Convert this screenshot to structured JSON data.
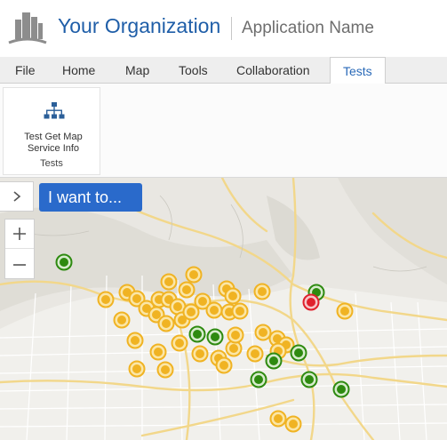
{
  "header": {
    "org_name": "Your Organization",
    "app_name": "Application Name",
    "logo_icon": "city-buildings-logo"
  },
  "ribbon": {
    "tabs": [
      {
        "label": "File",
        "active": false
      },
      {
        "label": "Home",
        "active": false
      },
      {
        "label": "Map",
        "active": false
      },
      {
        "label": "Tools",
        "active": false
      },
      {
        "label": "Collaboration",
        "active": false
      },
      {
        "label": "Tests",
        "active": true
      }
    ],
    "groups": [
      {
        "label": "Tests",
        "tools": [
          {
            "label": "Test Get Map Service Info",
            "icon": "hierarchy-icon"
          }
        ]
      }
    ]
  },
  "map": {
    "iwantto_label": "I want to...",
    "expand_icon": "chevron-right-icon",
    "zoom_in_icon": "plus-icon",
    "zoom_out_icon": "minus-icon",
    "marker_colors": {
      "yellow": "#f0b323",
      "green": "#2e8a10",
      "red": "#e0202c"
    }
  }
}
